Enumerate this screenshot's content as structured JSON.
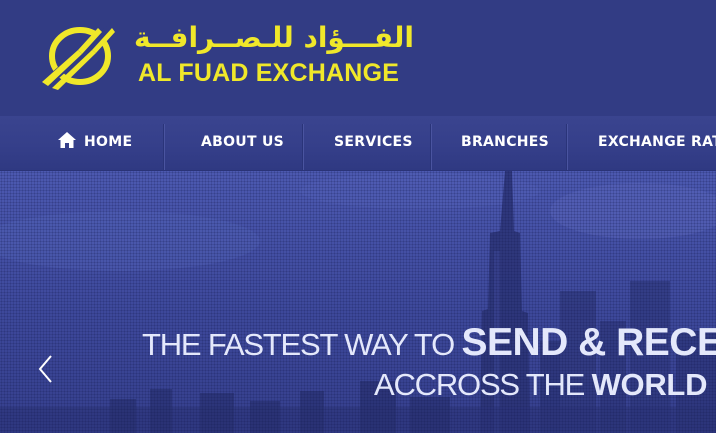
{
  "brand": {
    "arabic_name": "الفـــؤاد للـصــرافــة",
    "english_name": "AL FUAD EXCHANGE",
    "logo_color": "#f0e82a"
  },
  "nav": {
    "items": [
      {
        "label": "HOME",
        "icon": "home-icon"
      },
      {
        "label": "ABOUT US"
      },
      {
        "label": "SERVICES"
      },
      {
        "label": "BRANCHES"
      },
      {
        "label": "EXCHANGE RATES"
      }
    ]
  },
  "hero": {
    "line1_light": "THE FASTEST WAY TO ",
    "line1_bold": "SEND & RECEIVE",
    "line2_light": "ACCROSS THE ",
    "line2_bold": "WORLD",
    "prev_icon": "chevron-left-icon"
  },
  "colors": {
    "header_bg": "#323c84",
    "accent_yellow": "#f0e82a",
    "hero_text": "#e4e8fb"
  }
}
